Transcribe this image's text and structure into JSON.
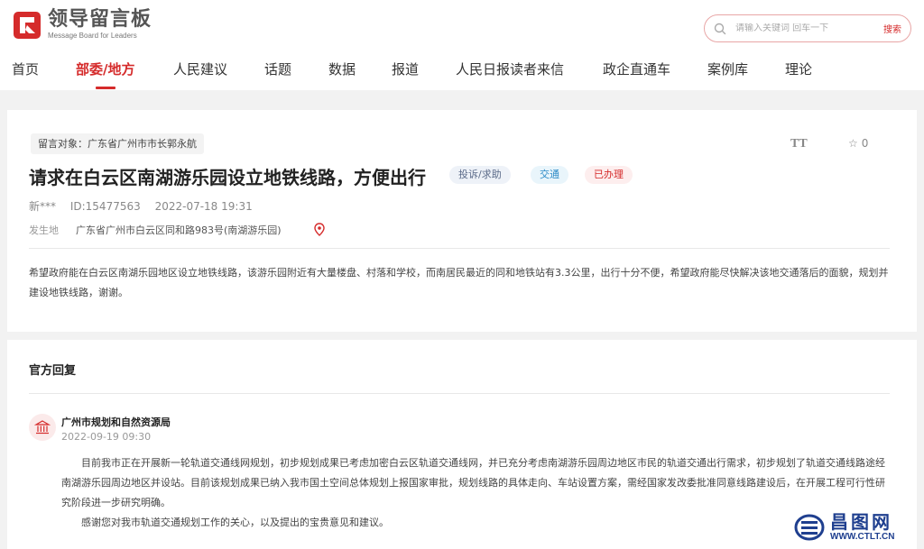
{
  "header": {
    "logo_title": "领导留言板",
    "logo_subtitle": "Message Board for Leaders",
    "search_placeholder": "请输入关键词 回车一下",
    "search_button": "搜索"
  },
  "nav": {
    "items": [
      {
        "label": "首页"
      },
      {
        "label": "部委/地方"
      },
      {
        "label": "人民建议"
      },
      {
        "label": "话题"
      },
      {
        "label": "数据"
      },
      {
        "label": "报道"
      },
      {
        "label": "人民日报读者来信"
      },
      {
        "label": "政企直通车"
      },
      {
        "label": "案例库"
      },
      {
        "label": "理论"
      }
    ],
    "active_index": 1
  },
  "message": {
    "target": "留言对象：广东省广州市市长郭永航",
    "font_toggle": "TT",
    "favorites": "0",
    "title": "请求在白云区南湖游乐园设立地铁线路，方便出行",
    "category_badge": "投诉/求助",
    "topic_badge": "交通",
    "status_badge": "已办理",
    "author": "新***",
    "id": "ID:15477563",
    "datetime": "2022-07-18 19:31",
    "location_label": "发生地",
    "location": "广东省广州市白云区同和路983号(南湖游乐园)",
    "content": "希望政府能在白云区南湖乐园地区设立地铁线路，该游乐园附近有大量楼盘、村落和学校，而南居民最近的同和地铁站有3.3公里，出行十分不便，希望政府能尽快解决该地交通落后的面貌，规划并建设地铁线路，谢谢。"
  },
  "reply": {
    "heading": "官方回复",
    "org": "广州市规划和自然资源局",
    "date": "2022-09-19 09:30",
    "paragraph1": "目前我市正在开展新一轮轨道交通线网规划，初步规划成果已考虑加密白云区轨道交通线网，并已充分考虑南湖游乐园周边地区市民的轨道交通出行需求，初步规划了轨道交通线路途经南湖游乐园周边地区并设站。目前该规划成果已纳入我市国土空间总体规划上报国家审批，规划线路的具体走向、车站设置方案，需经国家发改委批准同意线路建设后，在开展工程可行性研究阶段进一步研究明确。",
    "paragraph2": "感谢您对我市轨道交通规划工作的关心，以及提出的宝贵意见和建议。"
  },
  "watermark": {
    "name": "昌图网",
    "url": "WWW.CTLT.CN"
  },
  "colors": {
    "accent": "#d52b2b",
    "watermark": "#1f3f8f"
  }
}
